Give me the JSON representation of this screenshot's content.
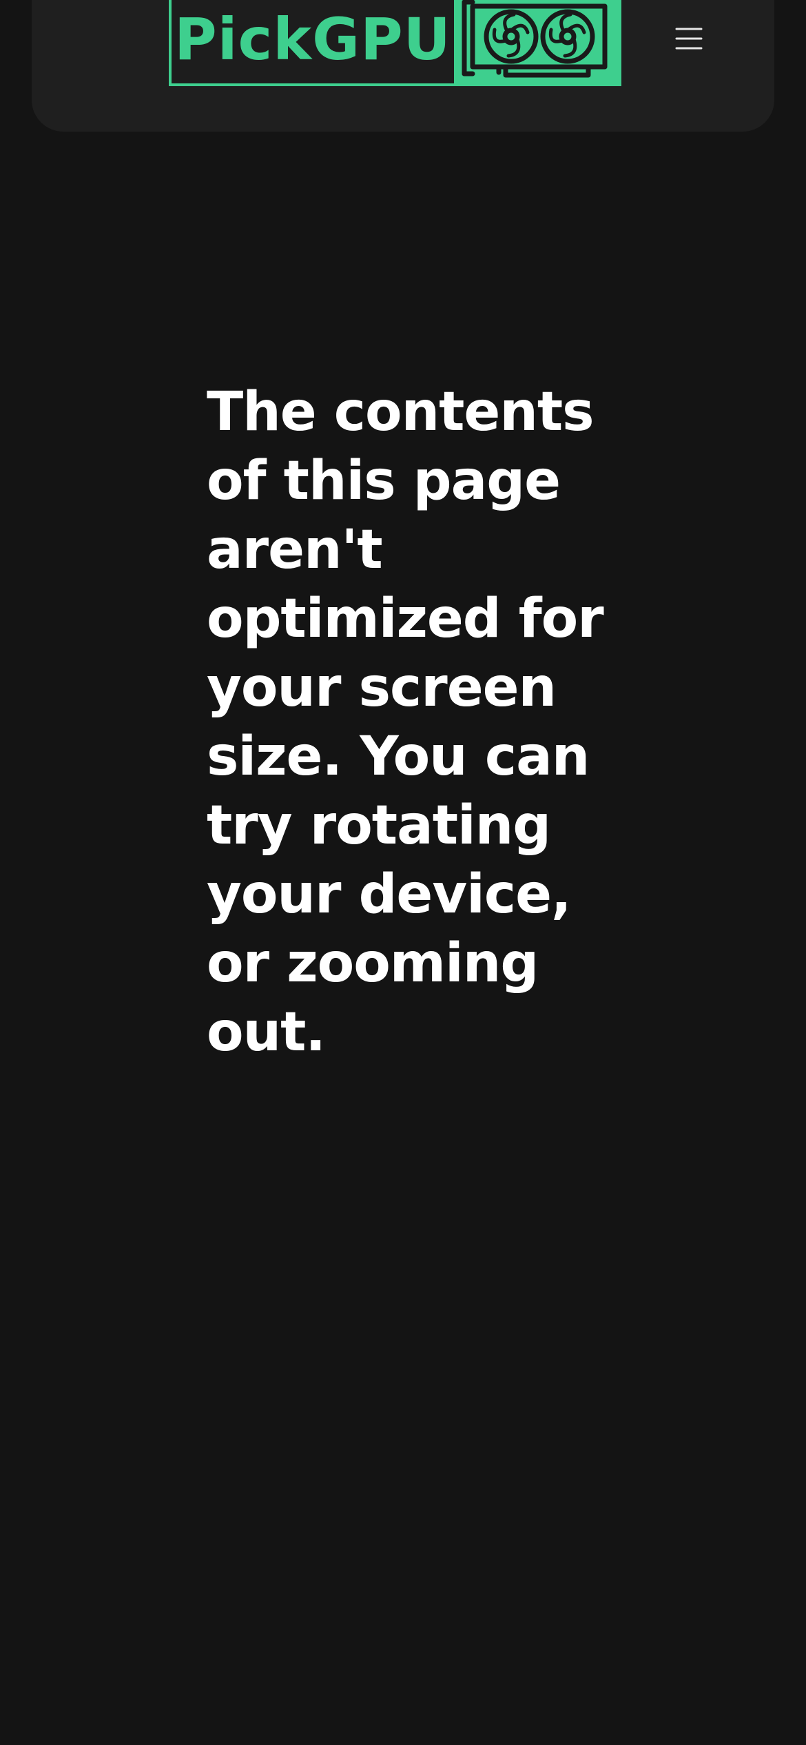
{
  "header": {
    "logo_text": "PickGPU",
    "logo_icon": "graphics-card-icon",
    "menu_icon": "hamburger-menu-icon"
  },
  "main": {
    "message": "The contents of this page aren't optimized for your screen size. You can try rotating your device, or zooming out."
  },
  "colors": {
    "background": "#141414",
    "header_background": "#1f1f1f",
    "brand_green": "#3ecf8e",
    "text": "#ffffff"
  }
}
